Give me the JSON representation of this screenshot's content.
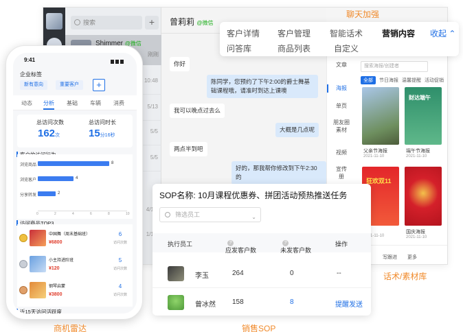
{
  "labels": {
    "chat_enhance": "聊天加强",
    "materials": "话术/素材库",
    "radar": "商机雷达",
    "sop": "销售SOP"
  },
  "tab_panel": {
    "row1": [
      "客户详情",
      "客户管理",
      "智能话术",
      "营销内容"
    ],
    "row2": [
      "问答库",
      "商品列表",
      "自定义"
    ],
    "collapse": "收起"
  },
  "desktop": {
    "search_placeholder": "搜索",
    "plus": "+",
    "active_contact": {
      "name": "Shimmer",
      "tag": "@微信",
      "status": "刚刚"
    },
    "stamps": [
      "10:48",
      "5/13",
      "5/5",
      "5/5",
      "4/11/",
      "1/11/"
    ],
    "chat": {
      "contact": "曾莉莉",
      "tag": "@微信",
      "messages": [
        {
          "side": "l",
          "text": "你好"
        },
        {
          "side": "r",
          "text": "陈同学，您预约了下午2:00的爵士舞基础课程哦，请准时到达上课噢"
        },
        {
          "side": "l",
          "text": "我可以晚点过去么"
        },
        {
          "side": "r",
          "text": "大概是几点呢"
        },
        {
          "side": "l",
          "text": "两点半到吧"
        },
        {
          "side": "r",
          "text": "好的，那我帮你修改到下午2:30的"
        }
      ]
    },
    "tools": [
      "文章",
      "海报",
      "单页",
      "朋友圈素材",
      "视频",
      "宣传册"
    ],
    "materials": {
      "search_placeholder": "搜索海报/创建者",
      "filters": [
        "全部",
        "节日海报",
        "温馨提醒",
        "活动促销"
      ],
      "posters": [
        {
          "title": "父亲节海报",
          "date": "2021-11-10",
          "text": ""
        },
        {
          "title": "端午节海报",
          "date": "2021-11-10",
          "text": "财达端午"
        },
        {
          "title": "",
          "date": "2021-11-10",
          "text": "狂欢双11"
        },
        {
          "title": "国庆海报",
          "date": "2021-11-10",
          "text": ""
        }
      ],
      "footer": [
        "待办",
        "写跟进",
        "更多"
      ]
    }
  },
  "phone": {
    "time": "9:41",
    "title": "企业标签",
    "chips": [
      "新有意向",
      "重要客户"
    ],
    "add": "+",
    "tabs": [
      "动态",
      "分析",
      "基础",
      "车辆",
      "消费"
    ],
    "stats": [
      {
        "label": "总访问次数",
        "value": "162",
        "unit": "次"
      },
      {
        "label": "总访问时长",
        "value": "15",
        "unit": "分16秒"
      }
    ],
    "behavior_title": "客户的访问行为",
    "top3_title": "访问商品TOP3",
    "recent_title": "近15天访问活跃度",
    "products": [
      {
        "name": "中国舞（周末基础班）",
        "price": "¥6800",
        "count": "6",
        "sub": "访问次数"
      },
      {
        "name": "小主持进阶班",
        "price": "¥120",
        "count": "5",
        "sub": "访问次数"
      },
      {
        "name": "钢琴启蒙",
        "price": "¥3800",
        "count": "4",
        "sub": "访问次数"
      }
    ]
  },
  "chart_data": {
    "type": "bar",
    "orientation": "horizontal",
    "title": "客户的访问行为",
    "categories": [
      "浏览商品",
      "浏览客户",
      "分享转发"
    ],
    "values": [
      8,
      4,
      2
    ],
    "xlim": [
      0,
      10
    ],
    "xticks": [
      "0",
      "2",
      "4",
      "6",
      "8",
      "10"
    ]
  },
  "sop": {
    "title": "SOP名称: 10月课程优惠券、拼团活动预热推送任务",
    "filter_placeholder": "筛选员工",
    "headers": [
      "执行员工",
      "应发客户数",
      "未发客户数",
      "操作"
    ],
    "rows": [
      {
        "name": "李玉",
        "sent": "264",
        "unsent": "0",
        "action": "--"
      },
      {
        "name": "曾冰然",
        "sent": "158",
        "unsent": "8",
        "action": "提醒发送"
      }
    ],
    "colors": {
      "accent": "#1f6fe5",
      "orange": "#f08a2b"
    }
  }
}
